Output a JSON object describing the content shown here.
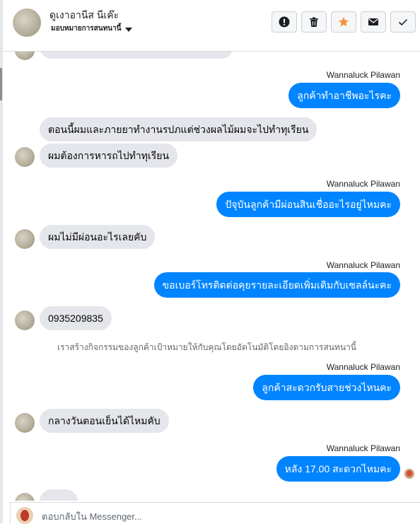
{
  "header": {
    "contact_name": "ดูเงาอานีส นีเค๊ะ",
    "assign_label": "มอบหมายการสนทนานี้"
  },
  "toolbar": {
    "items": [
      {
        "icon": "exclamation-icon",
        "color": "#1c1e21"
      },
      {
        "icon": "trash-icon",
        "color": "#1c1e21"
      },
      {
        "icon": "star-icon",
        "color": "#f7923b"
      },
      {
        "icon": "envelope-icon",
        "color": "#1c1e21"
      },
      {
        "icon": "check-icon",
        "color": "#1c1e21"
      }
    ]
  },
  "colors": {
    "outgoing_bubble": "#0084ff",
    "incoming_bubble": "#e4e6eb",
    "star": "#f7923b"
  },
  "conversation": {
    "sender_name": "Wannaluck Pilawan",
    "messages": [
      {
        "direction": "out",
        "text": "ลูกค้าทำอาชีพอะไรคะ"
      },
      {
        "direction": "in",
        "text": "ตอนนี้ผมและภายยาทำงานรปภแต่ช่วงผลไม้ผมจะไปทำทุเรียน"
      },
      {
        "direction": "in",
        "text": "ผมต้องการหารถไปทำทุเรียน"
      },
      {
        "direction": "out",
        "text": "ปัจุบันลูกค้ามีผ่อนสินเชื่ออะไรอยู่ไหมคะ"
      },
      {
        "direction": "in",
        "text": "ผมไม่มีผ่อนอะไรเลยคับ"
      },
      {
        "direction": "out",
        "text": "ขอเบอร์โทรติดต่อคุยรายละเอียดเพิ่มเติมกับเซลล์นะคะ"
      },
      {
        "direction": "in",
        "text": "0935209835"
      },
      {
        "direction": "out",
        "text": "ลูกค้าสะดวกรับสายช่วงไหนคะ"
      },
      {
        "direction": "in",
        "text": "กลางวันตอนเย็นได้ไหมคับ"
      },
      {
        "direction": "out",
        "text": "หลัง 17.00  สะดวกไหมคะ"
      }
    ],
    "system_note": "เราสร้างกิจกรรมของลูกค้าเป้าหมายให้กับคุณโดยอัตโนมัติโดยอิงตามการสนทนานี้"
  },
  "composer": {
    "placeholder": "ตอบกลับใน Messenger..."
  }
}
